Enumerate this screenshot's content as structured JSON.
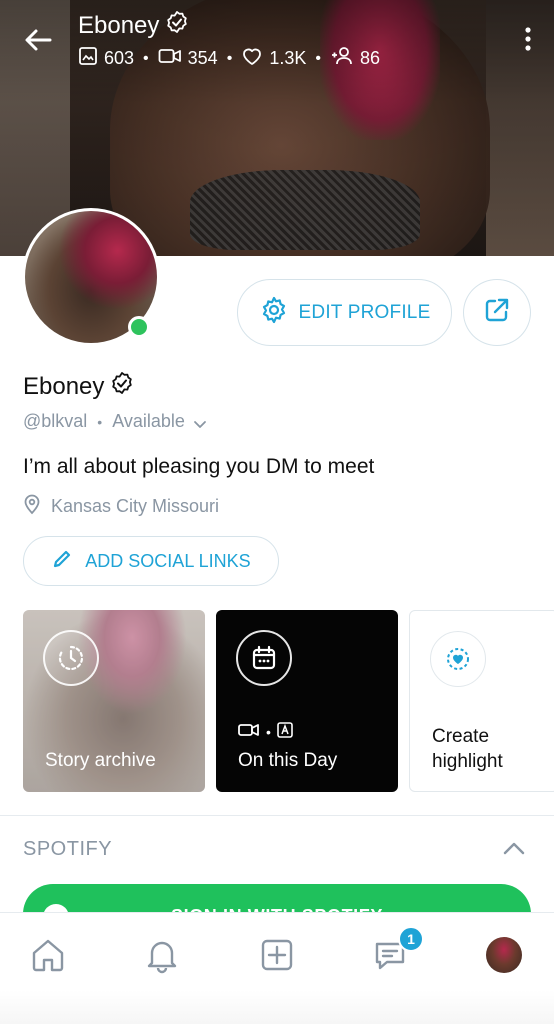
{
  "header": {
    "name": "Eboney",
    "stats": [
      {
        "icon": "image-icon",
        "value": "603"
      },
      {
        "icon": "video-icon",
        "value": "354"
      },
      {
        "icon": "heart-icon",
        "value": "1.3K"
      },
      {
        "icon": "subscribers-icon",
        "value": "86"
      }
    ]
  },
  "profile": {
    "name": "Eboney",
    "handle": "@blkval",
    "status": "Available",
    "bio": "I’m all about pleasing you DM to meet",
    "location": "Kansas City Missouri"
  },
  "buttons": {
    "edit_profile": "EDIT PROFILE",
    "add_social_links": "ADD SOCIAL LINKS"
  },
  "highlights": [
    {
      "label": "Story archive",
      "icon": "clock-icon"
    },
    {
      "label": "On this Day",
      "icon": "calendar-icon"
    },
    {
      "label": "Create\nhighlight",
      "icon": "heart-plus-icon"
    }
  ],
  "spotify": {
    "title": "SPOTIFY",
    "button_label": "SIGN IN WITH SPOTIFY"
  },
  "nav": {
    "message_badge": "1"
  },
  "colors": {
    "accent": "#1fa3d6",
    "online": "#2ec35d",
    "spotify": "#1fc15c",
    "muted": "#8a96a3"
  }
}
